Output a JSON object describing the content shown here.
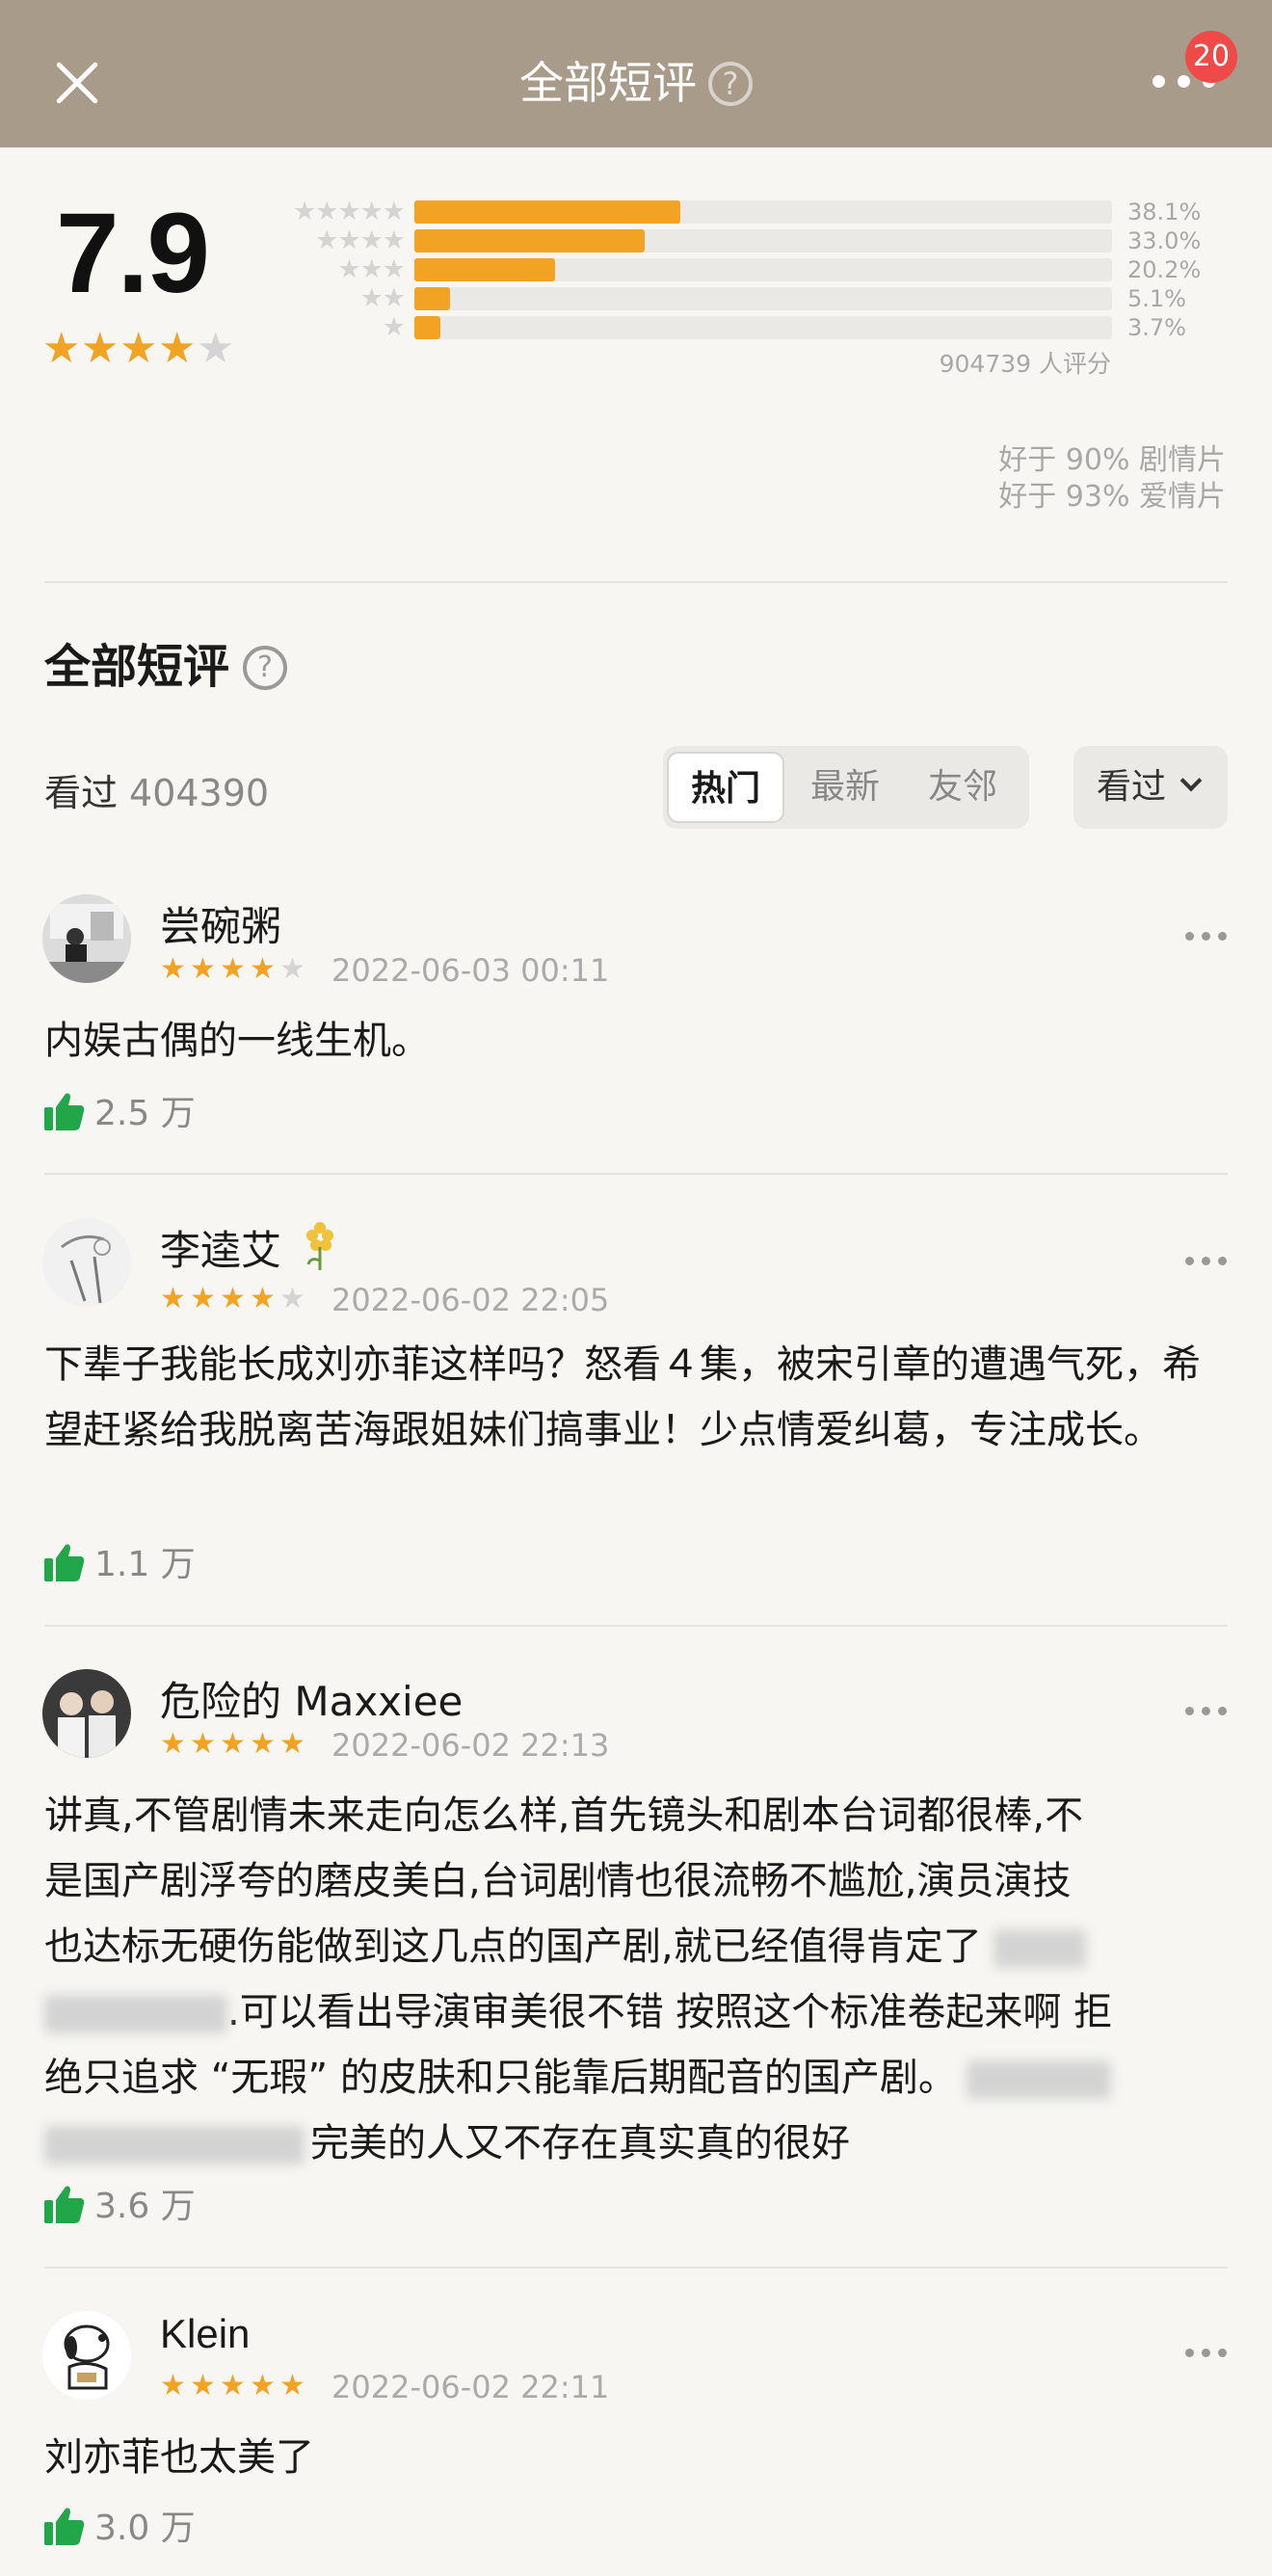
{
  "header": {
    "title": "全部短评",
    "help_icon": "question-circle-icon",
    "badge_count": "20"
  },
  "rating": {
    "score": "7.9",
    "stars_filled": 4,
    "distribution": [
      {
        "stars": 5,
        "percent": 38.1,
        "label": "38.1%"
      },
      {
        "stars": 4,
        "percent": 33.0,
        "label": "33.0%"
      },
      {
        "stars": 3,
        "percent": 20.2,
        "label": "20.2%"
      },
      {
        "stars": 2,
        "percent": 5.1,
        "label": "5.1%"
      },
      {
        "stars": 1,
        "percent": 3.7,
        "label": "3.7%"
      }
    ],
    "count_text": "904739 人评分",
    "better_than": [
      "好于 90% 剧情片",
      "好于 93% 爱情片"
    ]
  },
  "section": {
    "title": "全部短评",
    "watched_label": "看过",
    "watched_count": "404390",
    "tabs": [
      "热门",
      "最新",
      "友邻"
    ],
    "active_tab": "热门",
    "filter_label": "看过"
  },
  "comments": [
    {
      "user": "尝碗粥",
      "stars": 4,
      "date": "2022-06-03 00:11",
      "text": "内娱古偶的一线生机。",
      "likes": "2.5 万"
    },
    {
      "user": "李逵艾",
      "stars": 4,
      "date": "2022-06-02 22:05",
      "text": "下辈子我能长成刘亦菲这样吗？怒看４集，被宋引章的遭遇气死，希望赶紧给我脱离苦海跟姐妹们搞事业！少点情爱纠葛，专注成长。",
      "likes": "1.1 万"
    },
    {
      "user": "危险的 Maxxiee",
      "stars": 5,
      "date": "2022-06-02 22:13",
      "text_lines": [
        "讲真,不管剧情未来走向怎么样,首先镜头和剧本台词都很棒,不",
        "是国产剧浮夸的磨皮美白,台词剧情也很流畅不尴尬,演员演技",
        "也达标无硬伤能做到这几点的国产剧,就已经值得肯定了",
        ".可以看出导演审美很不错 按照这个标准卷起来啊 拒",
        "绝只追求 “无瑕” 的皮肤和只能靠后期配音的国产剧。",
        "完美的人又不存在真实真的很好"
      ],
      "likes": "3.6 万"
    },
    {
      "user": "Klein",
      "stars": 5,
      "date": "2022-06-02 22:11",
      "text": "刘亦菲也太美了",
      "likes": "3.0 万"
    }
  ],
  "colors": {
    "topbar": "#a99b89",
    "star": "#f3a323",
    "like_icon": "#22a64a",
    "badge": "#ef4a48"
  }
}
